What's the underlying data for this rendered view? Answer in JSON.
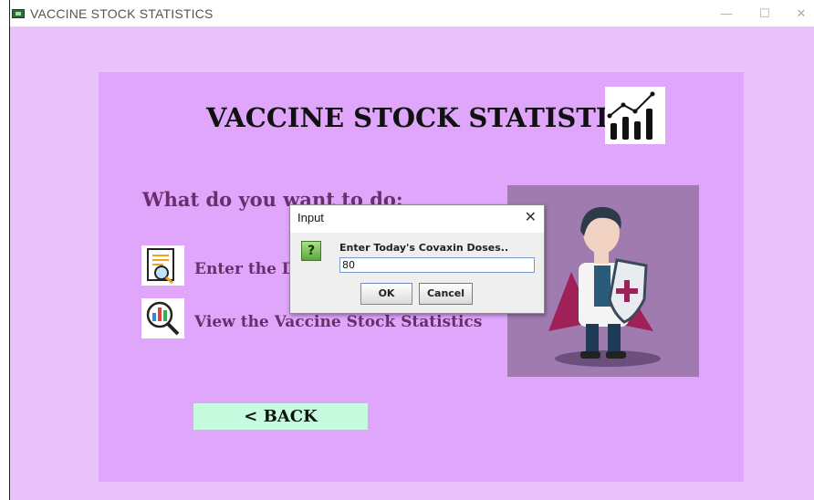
{
  "window": {
    "title": "VACCINE STOCK STATISTICS",
    "minimize_glyph": "—",
    "maximize_glyph": "☐",
    "close_glyph": "✕"
  },
  "main": {
    "title": "VACCINE STOCK STATISTICS",
    "question": "What do you want to do:",
    "options": [
      {
        "label": "Enter the D",
        "icon": "report-magnifier-icon"
      },
      {
        "label": "View the Vaccine Stock Statistics",
        "icon": "chart-magnifier-icon"
      }
    ],
    "back_label": "< BACK",
    "title_icon": "growth-chart-icon",
    "illustration": "doctor-with-shield-illustration"
  },
  "dialog": {
    "title": "Input",
    "close_glyph": "✕",
    "icon_glyph": "?",
    "message": "Enter Today's Covaxin Doses..",
    "input_value": "80",
    "ok_label": "OK",
    "cancel_label": "Cancel"
  },
  "colors": {
    "window_bg": "#e9c2fb",
    "panel_bg": "#dfa6fb",
    "accent_text": "#6a2f6b",
    "back_button_bg": "#c6fbe0",
    "illustration_bg": "#9f7bb0"
  }
}
